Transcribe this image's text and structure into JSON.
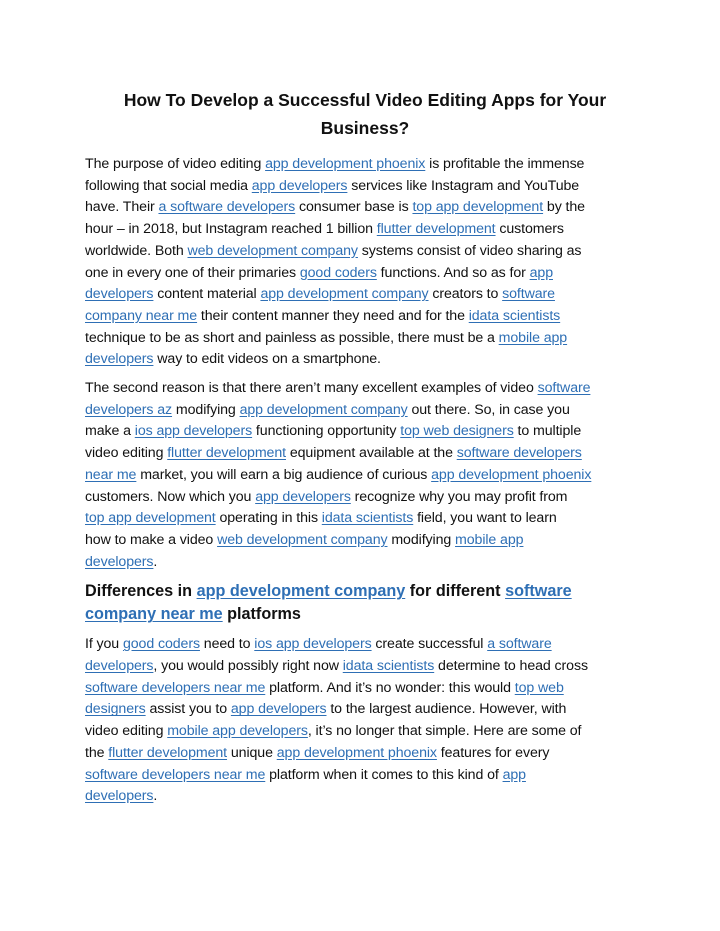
{
  "document": {
    "title_line1": "How To Develop a Successful Video Editing Apps for Your",
    "title_line2": "Business?",
    "link_color": "#2e6fb5",
    "paragraph1": [
      [
        {
          "t": "The purpose of video editing "
        },
        {
          "l": "app development phoenix"
        },
        {
          "t": " is profitable the immense"
        }
      ],
      [
        {
          "t": "following that social media "
        },
        {
          "l": "app developers"
        },
        {
          "t": " services like Instagram and YouTube"
        }
      ],
      [
        {
          "t": "have. Their "
        },
        {
          "l": "a software developers"
        },
        {
          "t": " consumer base is "
        },
        {
          "l": "top app development"
        },
        {
          "t": " by the"
        }
      ],
      [
        {
          "t": "hour – in 2018, but Instagram reached 1 billion "
        },
        {
          "l": "flutter development"
        },
        {
          "t": " customers"
        }
      ],
      [
        {
          "t": "worldwide. Both "
        },
        {
          "l": "web development company"
        },
        {
          "t": " systems consist of video sharing as"
        }
      ],
      [
        {
          "t": "one in every one of their primaries "
        },
        {
          "l": "good coders"
        },
        {
          "t": " functions. And so as for "
        },
        {
          "l": "app"
        }
      ],
      [
        {
          "l": "developers"
        },
        {
          "t": " content material "
        },
        {
          "l": "app development company"
        },
        {
          "t": " creators to "
        },
        {
          "l": "software"
        }
      ],
      [
        {
          "l": "company near me"
        },
        {
          "t": " their content manner they need and for the "
        },
        {
          "l": "idata scientists"
        }
      ],
      [
        {
          "t": "technique to be as short and painless as possible, there must be a "
        },
        {
          "l": "mobile app"
        }
      ],
      [
        {
          "l": "developers"
        },
        {
          "t": " way to edit videos on a smartphone."
        }
      ]
    ],
    "paragraph2": [
      [
        {
          "t": "The second reason is that there aren’t many excellent examples of video "
        },
        {
          "l": "software"
        }
      ],
      [
        {
          "l": "developers az"
        },
        {
          "t": " modifying "
        },
        {
          "l": "app development company"
        },
        {
          "t": " out there. So, in case you"
        }
      ],
      [
        {
          "t": "make a "
        },
        {
          "l": "ios app developers"
        },
        {
          "t": " functioning opportunity "
        },
        {
          "l": "top web designers"
        },
        {
          "t": " to multiple"
        }
      ],
      [
        {
          "t": "video editing "
        },
        {
          "l": "flutter development"
        },
        {
          "t": " equipment available at the "
        },
        {
          "l": "software developers"
        }
      ],
      [
        {
          "l": "near me"
        },
        {
          "t": " market, you will earn a big audience of curious "
        },
        {
          "l": "app development phoenix"
        }
      ],
      [
        {
          "t": "customers. Now which you "
        },
        {
          "l": "app developers"
        },
        {
          "t": " recognize why you may profit from"
        }
      ],
      [
        {
          "l": "top app development"
        },
        {
          "t": " operating in this "
        },
        {
          "l": "idata scientists"
        },
        {
          "t": " field, you want to learn"
        }
      ],
      [
        {
          "t": "how to make a video "
        },
        {
          "l": "web development company"
        },
        {
          "t": " modifying "
        },
        {
          "l": "mobile app"
        }
      ],
      [
        {
          "l": "developers"
        },
        {
          "t": "."
        }
      ]
    ],
    "heading": [
      [
        {
          "t": "Differences in "
        },
        {
          "l": "app development company"
        },
        {
          "t": " for different "
        },
        {
          "l": "software"
        }
      ],
      [
        {
          "l": "company near me"
        },
        {
          "t": " platforms"
        }
      ]
    ],
    "paragraph3": [
      [
        {
          "t": "If you "
        },
        {
          "l": "good coders"
        },
        {
          "t": " need to "
        },
        {
          "l": "ios app developers"
        },
        {
          "t": " create successful "
        },
        {
          "l": "a software"
        }
      ],
      [
        {
          "l": "developers"
        },
        {
          "t": ", you would possibly right now "
        },
        {
          "l": "idata scientists"
        },
        {
          "t": " determine to head cross"
        }
      ],
      [
        {
          "l": "software developers near me"
        },
        {
          "t": " platform. And it’s no wonder: this would "
        },
        {
          "l": "top web"
        }
      ],
      [
        {
          "l": "designers"
        },
        {
          "t": " assist you to "
        },
        {
          "l": "app developers"
        },
        {
          "t": " to the largest audience. However, with"
        }
      ],
      [
        {
          "t": "video editing "
        },
        {
          "l": "mobile app developers"
        },
        {
          "t": ", it’s no longer that simple. Here are some of"
        }
      ],
      [
        {
          "t": "the "
        },
        {
          "l": "flutter development"
        },
        {
          "t": " unique "
        },
        {
          "l": "app development phoenix"
        },
        {
          "t": " features for every"
        }
      ],
      [
        {
          "l": "software developers near me"
        },
        {
          "t": " platform when it comes to this kind of "
        },
        {
          "l": "app"
        }
      ],
      [
        {
          "l": "developers"
        },
        {
          "t": "."
        }
      ]
    ]
  }
}
